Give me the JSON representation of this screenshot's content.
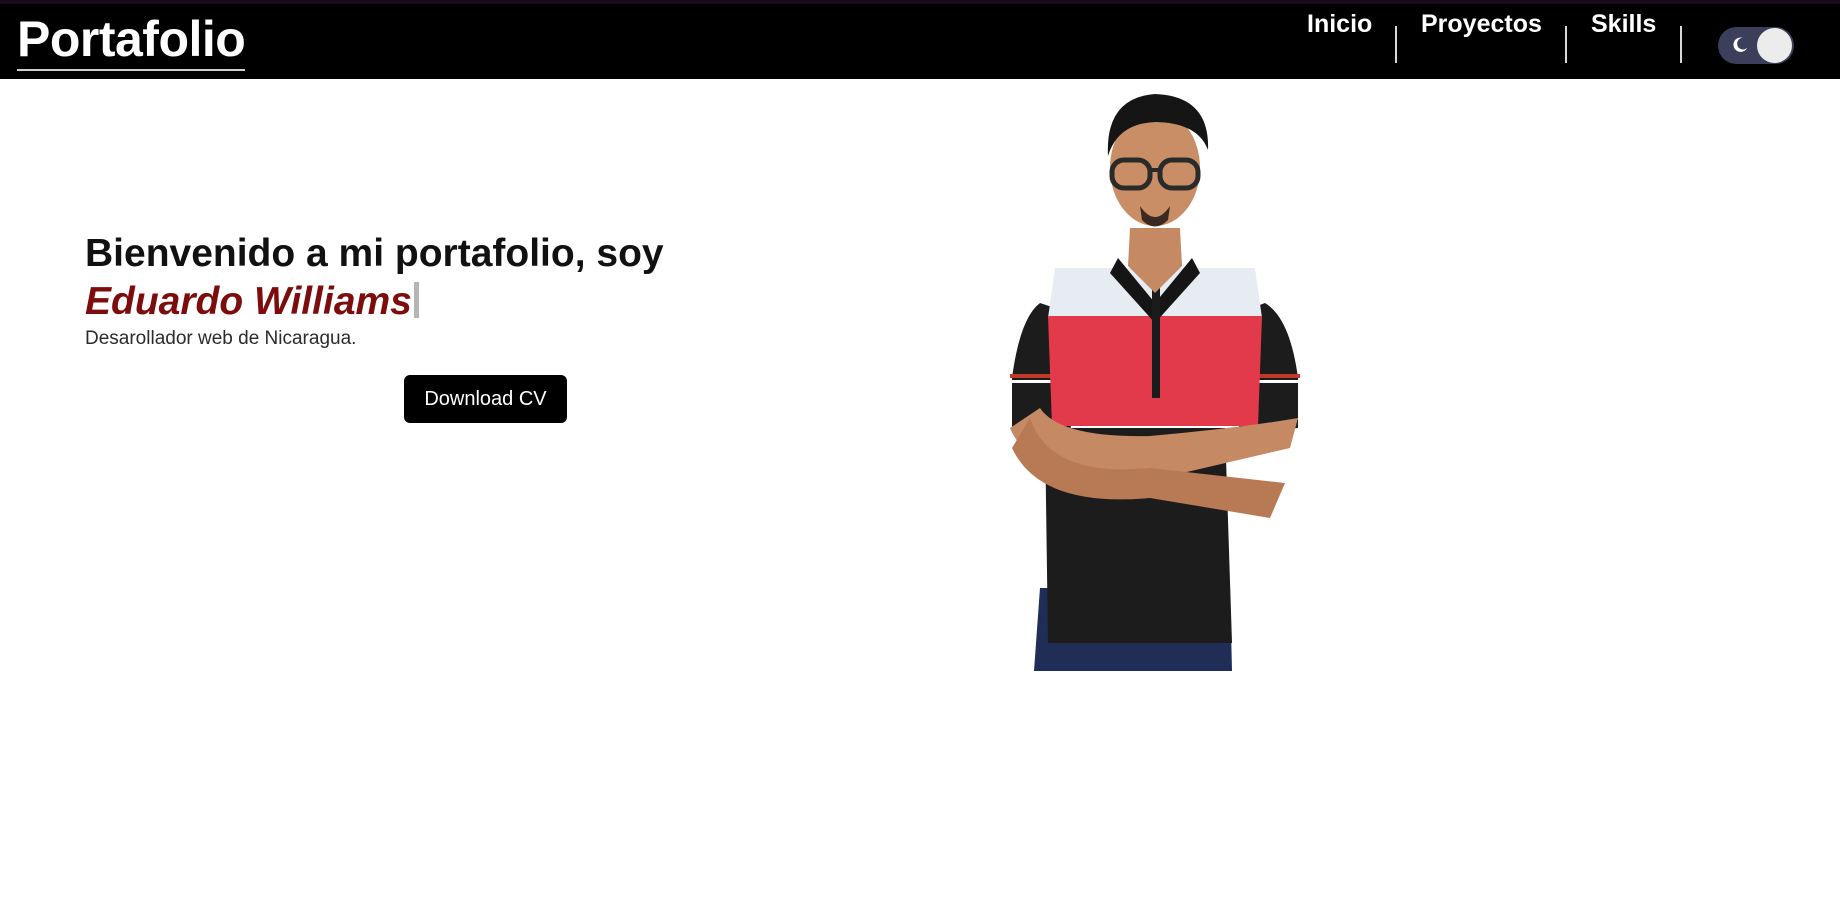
{
  "header": {
    "brand": "Portafolio",
    "nav": [
      {
        "label": "Inicio"
      },
      {
        "label": "Proyectos"
      },
      {
        "label": "Skills"
      }
    ],
    "theme_toggle": {
      "icon": "moon-icon",
      "state": "light"
    }
  },
  "hero": {
    "welcome": "Bienvenido a mi portafolio, soy",
    "name": "Eduardo Williams",
    "subtitle": "Desarollador web de Nicaragua.",
    "cv_button": "Download CV"
  },
  "colors": {
    "header_bg": "#000000",
    "accent_name": "#7d0c0c",
    "toggle_track": "#3b3f5c",
    "button_bg": "#000000"
  }
}
